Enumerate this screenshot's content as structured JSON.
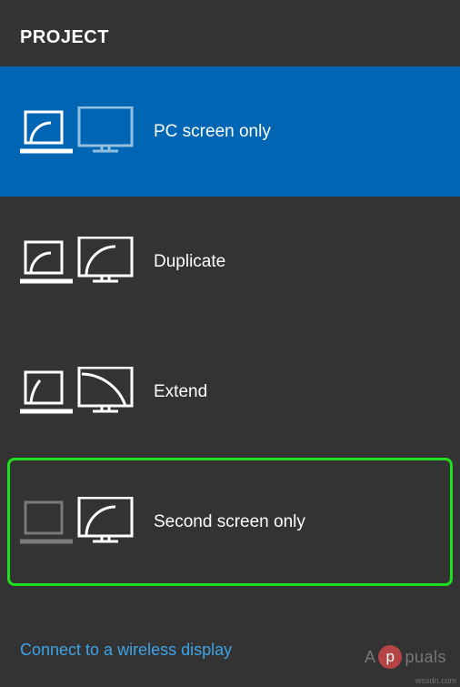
{
  "header": {
    "title": "PROJECT"
  },
  "options": [
    {
      "id": "pc-only",
      "label": "PC screen only",
      "selected": true,
      "highlighted": false
    },
    {
      "id": "duplicate",
      "label": "Duplicate",
      "selected": false,
      "highlighted": false
    },
    {
      "id": "extend",
      "label": "Extend",
      "selected": false,
      "highlighted": false
    },
    {
      "id": "second-only",
      "label": "Second screen only",
      "selected": false,
      "highlighted": true
    }
  ],
  "footer": {
    "link_label": "Connect to a wireless display"
  },
  "watermark": {
    "prefix": "A",
    "badge": "p",
    "suffix": "puals"
  },
  "source": "wsxdn.com"
}
